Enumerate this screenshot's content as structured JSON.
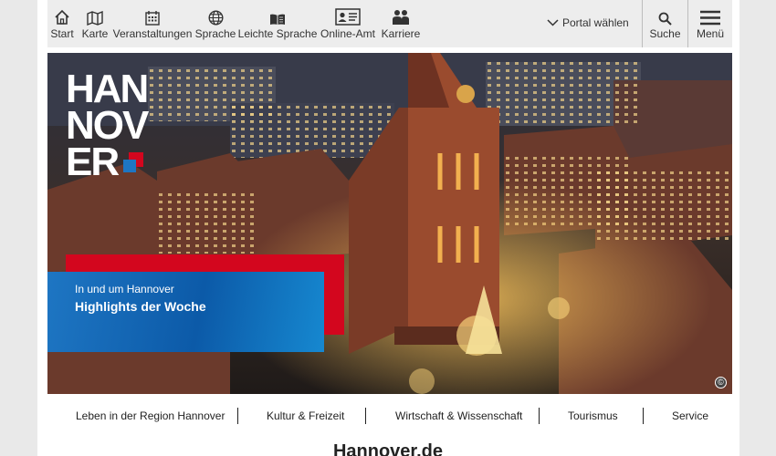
{
  "topnav": {
    "items": [
      {
        "label": "Start",
        "icon": "home-icon"
      },
      {
        "label": "Karte",
        "icon": "map-icon"
      },
      {
        "label": "Veranstaltungen",
        "icon": "calendar-icon"
      },
      {
        "label": "Sprache",
        "icon": "globe-icon"
      },
      {
        "label": "Leichte Sprache",
        "icon": "easy-language-icon"
      },
      {
        "label": "Online-Amt",
        "icon": "id-card-icon"
      },
      {
        "label": "Karriere",
        "icon": "people-icon"
      }
    ],
    "portal_label": "Portal wählen",
    "search_label": "Suche",
    "menu_label": "Menü"
  },
  "hero": {
    "logo_lines": [
      "HAN",
      "NOV",
      "ER"
    ],
    "teaser_kicker": "In und um Hannover",
    "teaser_headline": "Highlights der Woche",
    "copyright_symbol": "©"
  },
  "secondary_nav": [
    "Leben in der Region Hannover",
    "Kultur & Freizeit",
    "Wirtschaft & Wissenschaft",
    "Tourismus",
    "Service"
  ],
  "site_title": "Hannover.de",
  "colors": {
    "brand_red": "#d3061e",
    "brand_blue": "#0c5aa8",
    "topbar_bg": "#ededed"
  }
}
